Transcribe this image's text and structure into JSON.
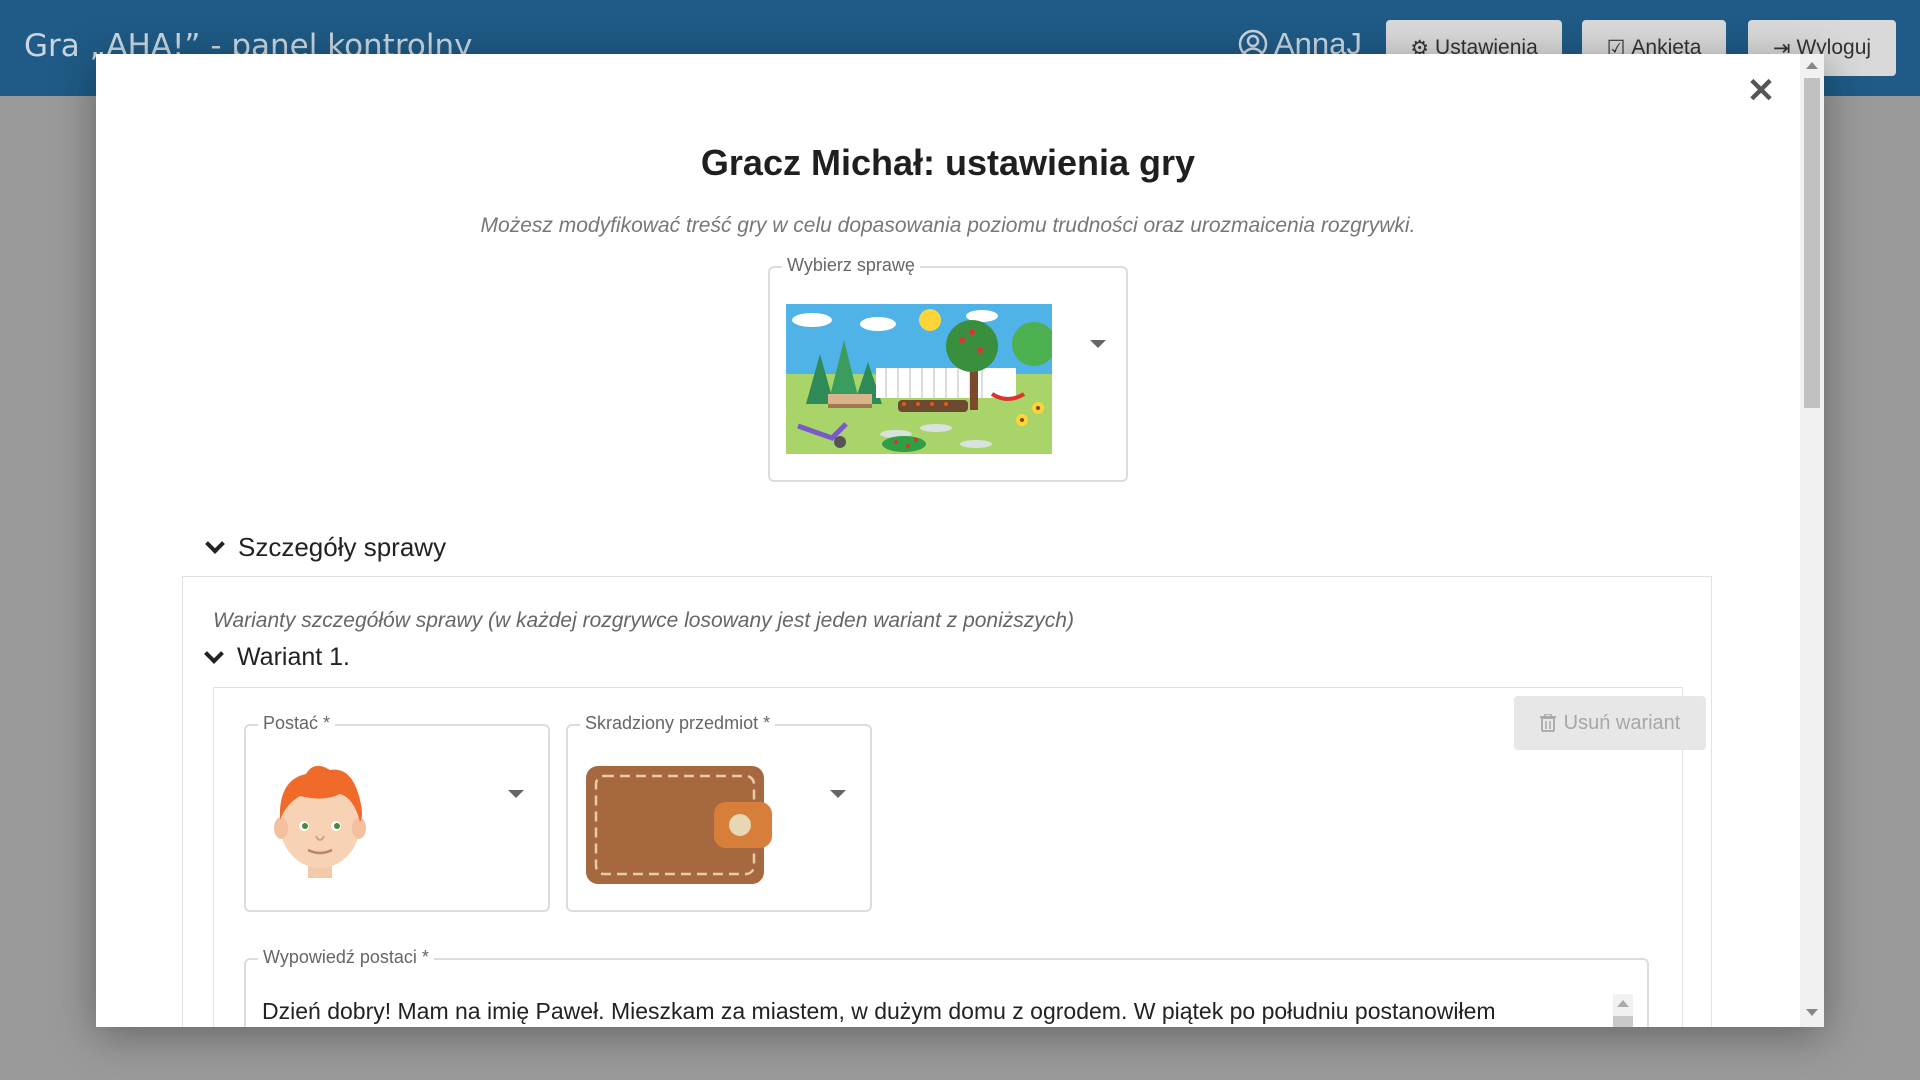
{
  "header": {
    "app_title": "Gra „AHA!” - panel kontrolny",
    "username": "AnnaJ",
    "settings_label": "Ustawienia",
    "survey_label": "Ankieta",
    "logout_label": "Wyloguj"
  },
  "modal": {
    "title": "Gracz Michał: ustawienia gry",
    "subtitle": "Możesz modyfikować treść gry w celu dopasowania poziomu trudności oraz urozmaicenia rozgrywki.",
    "case_select_label": "Wybierz sprawę",
    "case_details_heading": "Szczegóły sprawy",
    "variants_note": "Warianty szczegółów sprawy (w każdej rozgrywce losowany jest jeden wariant z poniższych)",
    "variant_heading": "Wariant 1.",
    "remove_variant_label": "Usuń wariant",
    "character_label": "Postać *",
    "stolen_item_label": "Skradziony przedmiot *",
    "statement_label": "Wypowiedź postaci *",
    "statement_text": "Dzień dobry! Mam na imię Paweł. Mieszkam za miastem, w dużym domu z ogrodem. W piątek po południu postanowiłem"
  },
  "icons": {
    "user": "user-circle-icon",
    "settings": "gear-icon",
    "survey": "checkbox-icon",
    "logout": "sign-out-icon",
    "close": "close-icon",
    "trash": "trash-icon",
    "chevron": "chevron-down-icon",
    "dropdown": "caret-down-icon"
  },
  "colors": {
    "topbar": "#1f5b86",
    "overlay": "#9a9a9a",
    "button_bg": "#d9d9d9",
    "disabled_text": "#a7a7a7"
  }
}
